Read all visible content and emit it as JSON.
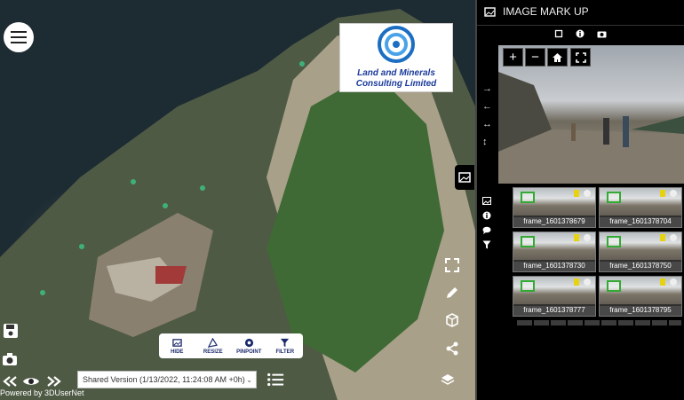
{
  "viewer": {
    "logo_lines": [
      "Land and Minerals",
      "Consulting Limited"
    ],
    "toolbar": [
      {
        "label": "HIDE",
        "icon": "image-icon"
      },
      {
        "label": "RESIZE",
        "icon": "resize-icon"
      },
      {
        "label": "PINPOINT",
        "icon": "pinpoint-icon"
      },
      {
        "label": "FILTER",
        "icon": "filter-icon"
      }
    ],
    "version_text": "Shared Version (1/13/2022, 11:24:08 AM +0h)",
    "powered_by": "Powered by 3DUserNet"
  },
  "panel": {
    "title": "IMAGE MARK UP",
    "viewer_buttons": [
      "+",
      "−"
    ],
    "thumbnails": [
      "frame_1601378679",
      "frame_1601378704",
      "frame_1601378730",
      "frame_1601378750",
      "frame_1601378777",
      "frame_1601378795"
    ]
  },
  "colors": {
    "panel_bg": "#000000",
    "toolbar_text": "#1a2a6a",
    "tag_yellow": "#e6d20f"
  }
}
